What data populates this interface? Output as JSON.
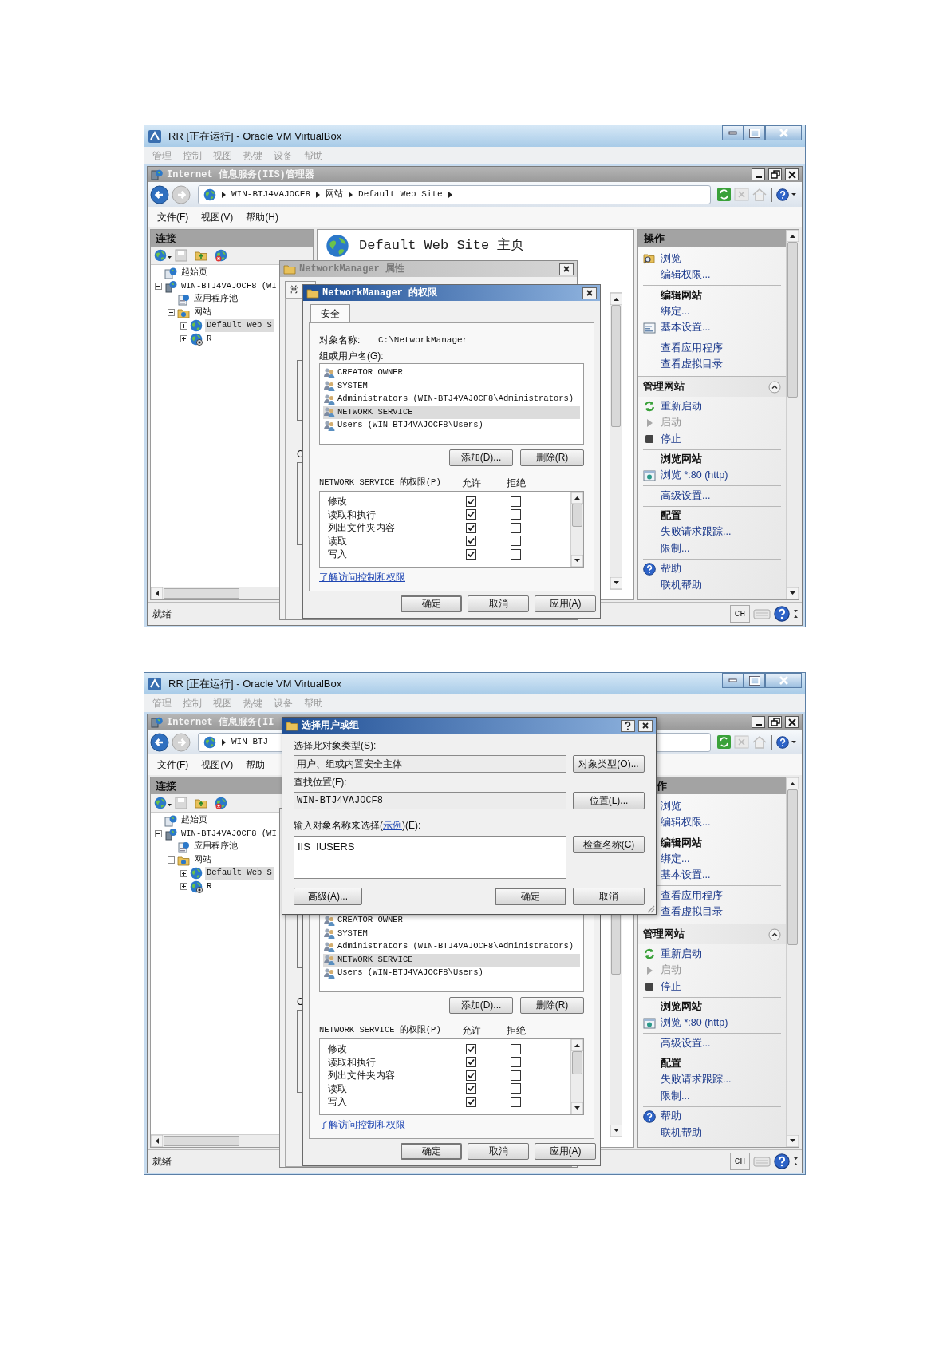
{
  "screenshots": [
    {
      "vm_window": {
        "title": "RR [正在运行] - Oracle VM VirtualBox",
        "menu": [
          "管理",
          "控制",
          "视图",
          "热键",
          "设备",
          "帮助"
        ]
      },
      "iis_window": {
        "title": "Internet 信息服务(IIS)管理器",
        "address": [
          "WIN-BTJ4VAJOCF8",
          "网站",
          "Default Web Site"
        ],
        "menu": [
          "文件(F)",
          "视图(V)",
          "帮助(H)"
        ]
      },
      "connections": {
        "title": "连接",
        "tree": [
          {
            "label": "起始页",
            "kind": "start",
            "selected": false
          },
          {
            "label": "WIN-BTJ4VAJOCF8 (WI",
            "kind": "server",
            "expanded": true,
            "selected": false,
            "children": [
              {
                "label": "应用程序池",
                "kind": "pool",
                "selected": false
              },
              {
                "label": "网站",
                "kind": "sites",
                "expanded": true,
                "selected": false,
                "children": [
                  {
                    "label": "Default Web S",
                    "kind": "site",
                    "expanded": false,
                    "selected": true
                  },
                  {
                    "label": "R",
                    "kind": "site_stopped",
                    "expanded": false,
                    "selected": false
                  }
                ]
              }
            ]
          }
        ]
      },
      "content": {
        "title": "Default Web Site 主页"
      },
      "actions": {
        "title": "操作",
        "groups": [
          {
            "kind": "group",
            "items": [
              {
                "label": "浏览",
                "kind": "browse",
                "disabled": false
              },
              {
                "label": "编辑权限...",
                "kind": "link",
                "disabled": false
              }
            ]
          },
          {
            "kind": "group",
            "header": "编辑网站",
            "items": [
              {
                "label": "绑定...",
                "kind": "link",
                "disabled": false
              },
              {
                "label": "基本设置...",
                "kind": "settings",
                "disabled": false
              }
            ]
          },
          {
            "kind": "group",
            "items": [
              {
                "label": "查看应用程序",
                "kind": "link",
                "disabled": false
              },
              {
                "label": "查看虚拟目录",
                "kind": "link",
                "disabled": false
              }
            ]
          },
          {
            "kind": "section",
            "title": "管理网站",
            "expanded": true
          },
          {
            "kind": "group",
            "items": [
              {
                "label": "重新启动",
                "kind": "restart",
                "disabled": false
              },
              {
                "label": "启动",
                "kind": "start",
                "disabled": true
              },
              {
                "label": "停止",
                "kind": "stop",
                "disabled": false
              }
            ]
          },
          {
            "kind": "group",
            "header": "浏览网站",
            "items": [
              {
                "label": "浏览 *:80 (http)",
                "kind": "site",
                "disabled": false
              }
            ]
          },
          {
            "kind": "group",
            "items": [
              {
                "label": "高级设置...",
                "kind": "link",
                "disabled": false
              }
            ]
          },
          {
            "kind": "group",
            "header": "配置",
            "items": [
              {
                "label": "失败请求跟踪...",
                "kind": "link",
                "disabled": false
              },
              {
                "label": "限制...",
                "kind": "link",
                "disabled": false
              }
            ]
          },
          {
            "kind": "group",
            "items": [
              {
                "label": "帮助",
                "kind": "help",
                "disabled": false
              },
              {
                "label": "联机帮助",
                "kind": "link",
                "disabled": false
              }
            ]
          }
        ]
      },
      "status_bar": {
        "text": "就绪",
        "language": "CH"
      },
      "dialogs": [
        {
          "kind": "properties",
          "title": "NetworkManager 属性",
          "tab": "常",
          "labels": [
            "C"
          ]
        },
        {
          "kind": "permissions",
          "title": "NetworkManager 的权限",
          "tab": {
            "label": "安全",
            "selected": true
          },
          "object_label": "对象名称:",
          "object_name": "C:\\NetworkManager",
          "users_label": "组或用户名(G):",
          "users": [
            {
              "name": "CREATOR OWNER",
              "selected": false
            },
            {
              "name": "SYSTEM",
              "selected": false
            },
            {
              "name": "Administrators (WIN-BTJ4VAJOCF8\\Administrators)",
              "selected": false
            },
            {
              "name": "NETWORK SERVICE",
              "selected": true
            },
            {
              "name": "Users (WIN-BTJ4VAJOCF8\\Users)",
              "selected": false
            }
          ],
          "buttons": [
            "添加(D)...",
            "删除(R)"
          ],
          "permissions_label": "NETWORK SERVICE 的权限(P)",
          "columns": [
            "允许",
            "拒绝"
          ],
          "permissions": [
            {
              "name": "修改",
              "allow": true,
              "deny": false
            },
            {
              "name": "读取和执行",
              "allow": true,
              "deny": false
            },
            {
              "name": "列出文件夹内容",
              "allow": true,
              "deny": false
            },
            {
              "name": "读取",
              "allow": true,
              "deny": false
            },
            {
              "name": "写入",
              "allow": true,
              "deny": false
            }
          ],
          "link": "了解访问控制和权限",
          "footer_buttons": [
            "确定",
            "取消",
            "应用(A)"
          ]
        }
      ]
    },
    {
      "vm_window": {
        "title": "RR [正在运行] - Oracle VM VirtualBox",
        "menu": [
          "管理",
          "控制",
          "视图",
          "热键",
          "设备",
          "帮助"
        ]
      },
      "iis_window": {
        "title": "Internet 信息服务(II",
        "address": [
          "WIN-BTJ"
        ],
        "menu": [
          "文件(F)",
          "视图(V)",
          "帮助"
        ]
      },
      "connections": {
        "title": "连接",
        "tree": [
          {
            "label": "起始页",
            "kind": "start",
            "selected": false
          },
          {
            "label": "WIN-BTJ4VAJOCF8 (WI",
            "kind": "server",
            "expanded": true,
            "selected": false,
            "children": [
              {
                "label": "应用程序池",
                "kind": "pool",
                "selected": false
              },
              {
                "label": "网站",
                "kind": "sites",
                "expanded": true,
                "selected": false,
                "children": [
                  {
                    "label": "Default Web S",
                    "kind": "site",
                    "expanded": false,
                    "selected": true
                  },
                  {
                    "label": "R",
                    "kind": "site_stopped",
                    "expanded": false,
                    "selected": false
                  }
                ]
              }
            ]
          }
        ]
      },
      "actions": {
        "title": "作",
        "groups": [
          {
            "kind": "group",
            "items": [
              {
                "label": "浏览",
                "kind": "link",
                "disabled": false
              },
              {
                "label": "编辑权限...",
                "kind": "link",
                "disabled": false
              }
            ]
          },
          {
            "kind": "group",
            "header": "编辑网站",
            "items": [
              {
                "label": "绑定...",
                "kind": "link",
                "disabled": false
              },
              {
                "label": "基本设置...",
                "kind": "link",
                "disabled": false
              }
            ]
          },
          {
            "kind": "group",
            "items": [
              {
                "label": "查看应用程序",
                "kind": "link",
                "disabled": false
              },
              {
                "label": "查看虚拟目录",
                "kind": "link",
                "disabled": false
              }
            ]
          },
          {
            "kind": "section",
            "title": "管理网站",
            "expanded": true
          },
          {
            "kind": "group",
            "items": [
              {
                "label": "重新启动",
                "kind": "restart",
                "disabled": false
              },
              {
                "label": "启动",
                "kind": "start",
                "disabled": true
              },
              {
                "label": "停止",
                "kind": "stop",
                "disabled": false
              }
            ]
          },
          {
            "kind": "group",
            "header": "浏览网站",
            "items": [
              {
                "label": "浏览 *:80 (http)",
                "kind": "site",
                "disabled": false
              }
            ]
          },
          {
            "kind": "group",
            "items": [
              {
                "label": "高级设置...",
                "kind": "link",
                "disabled": false
              }
            ]
          },
          {
            "kind": "group",
            "header": "配置",
            "items": [
              {
                "label": "失败请求跟踪...",
                "kind": "link",
                "disabled": false
              },
              {
                "label": "限制...",
                "kind": "link",
                "disabled": false
              }
            ]
          },
          {
            "kind": "group",
            "items": [
              {
                "label": "帮助",
                "kind": "help",
                "disabled": false
              },
              {
                "label": "联机帮助",
                "kind": "link",
                "disabled": false
              }
            ]
          }
        ]
      },
      "status_bar": {
        "text": "就绪",
        "language": "CH"
      },
      "dialogs": [
        {
          "kind": "select_user",
          "title": "选择用户或组",
          "object_type_label": "选择此对象类型(S):",
          "object_type": "用户、组或内置安全主体",
          "object_type_button": "对象类型(O)...",
          "location_label": "查找位置(F):",
          "location": "WIN-BTJ4VAJOCF8",
          "location_button": "位置(L)...",
          "names_label": {
            "before": "输入对象名称来选择(",
            "link": "示例",
            "after": ")(E):"
          },
          "names_value": "IIS_IUSERS",
          "check_button": "检查名称(C)",
          "advanced_button": "高级(A)...",
          "buttons": [
            "确定",
            "取消"
          ]
        },
        {
          "kind": "properties",
          "labels": [
            "C"
          ]
        },
        {
          "kind": "permissions",
          "users": [
            {
              "name": "CREATOR OWNER",
              "selected": false
            },
            {
              "name": "SYSTEM",
              "selected": false
            },
            {
              "name": "Administrators (WIN-BTJ4VAJOCF8\\Administrators)",
              "selected": false
            },
            {
              "name": "NETWORK SERVICE",
              "selected": true
            },
            {
              "name": "Users (WIN-BTJ4VAJOCF8\\Users)",
              "selected": false
            }
          ],
          "buttons": [
            "添加(D)...",
            "删除(R)"
          ],
          "permissions_label": "NETWORK SERVICE 的权限(P)",
          "columns": [
            "允许",
            "拒绝"
          ],
          "permissions": [
            {
              "name": "修改",
              "allow": true,
              "deny": false
            },
            {
              "name": "读取和执行",
              "allow": true,
              "deny": false
            },
            {
              "name": "列出文件夹内容",
              "allow": true,
              "deny": false
            },
            {
              "name": "读取",
              "allow": true,
              "deny": false
            },
            {
              "name": "写入",
              "allow": true,
              "deny": false
            }
          ],
          "link": "了解访问控制和权限",
          "footer_buttons": [
            "确定",
            "取消",
            "应用(A)"
          ]
        }
      ]
    }
  ]
}
